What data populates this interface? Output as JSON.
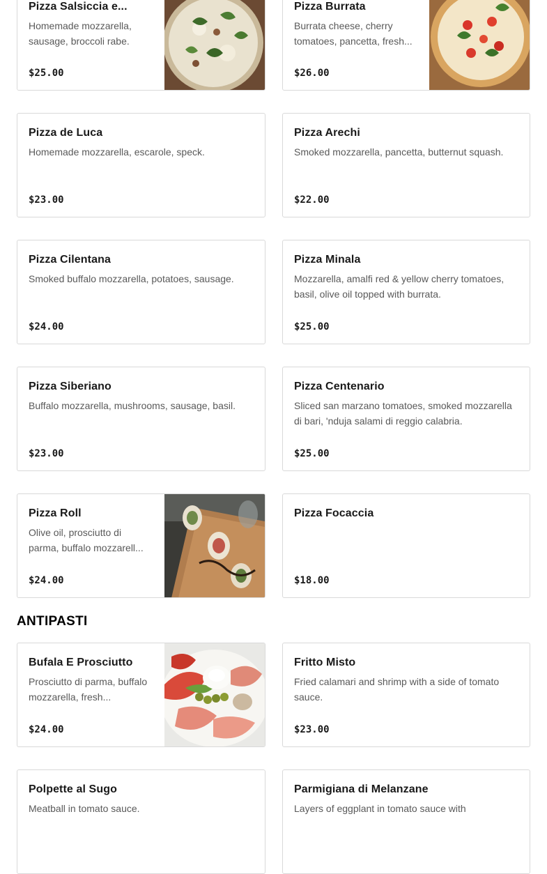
{
  "pizza_items": [
    {
      "name": "Pizza Salsiccia e...",
      "description": "Homemade mozzarella, sausage, broccoli rabe.",
      "price": "$25.00",
      "image": "pizza-salsiccia-photo"
    },
    {
      "name": "Pizza Burrata",
      "description": "Burrata cheese, cherry tomatoes, pancetta, fresh...",
      "price": "$26.00",
      "image": "pizza-burrata-photo"
    },
    {
      "name": "Pizza de Luca",
      "description": "Homemade mozzarella, escarole, speck.",
      "price": "$23.00"
    },
    {
      "name": "Pizza Arechi",
      "description": "Smoked mozzarella, pancetta, butternut squash.",
      "price": "$22.00"
    },
    {
      "name": "Pizza Cilentana",
      "description": "Smoked buffalo mozzarella, potatoes, sausage.",
      "price": "$24.00"
    },
    {
      "name": "Pizza Minala",
      "description": "Mozzarella, amalfi red & yellow cherry tomatoes, basil, olive oil topped with burrata.",
      "price": "$25.00"
    },
    {
      "name": "Pizza Siberiano",
      "description": "Buffalo mozzarella, mushrooms, sausage, basil.",
      "price": "$23.00"
    },
    {
      "name": "Pizza Centenario",
      "description": "Sliced san marzano tomatoes, smoked mozzarella di bari, 'nduja salami di reggio calabria.",
      "price": "$25.00"
    },
    {
      "name": "Pizza Roll",
      "description": "Olive oil, prosciutto di parma, buffalo mozzarell...",
      "price": "$24.00",
      "image": "pizza-roll-photo"
    },
    {
      "name": "Pizza Focaccia",
      "description": "",
      "price": "$18.00"
    }
  ],
  "antipasti_section": {
    "title": "ANTIPASTI",
    "items": [
      {
        "name": "Bufala E Prosciutto",
        "description": "Prosciutto di parma, buffalo mozzarella, fresh...",
        "price": "$24.00",
        "image": "bufala-prosciutto-photo"
      },
      {
        "name": "Fritto Misto",
        "description": "Fried calamari and shrimp with a side of tomato sauce.",
        "price": "$23.00"
      },
      {
        "name": "Polpette al Sugo",
        "description": "Meatball in tomato sauce.",
        "price": ""
      },
      {
        "name": "Parmigiana di Melanzane",
        "description": "Layers of eggplant in tomato sauce with",
        "price": ""
      }
    ]
  },
  "colors": {
    "border": "#d9d9d9",
    "text": "#191919",
    "muted": "#595959"
  }
}
